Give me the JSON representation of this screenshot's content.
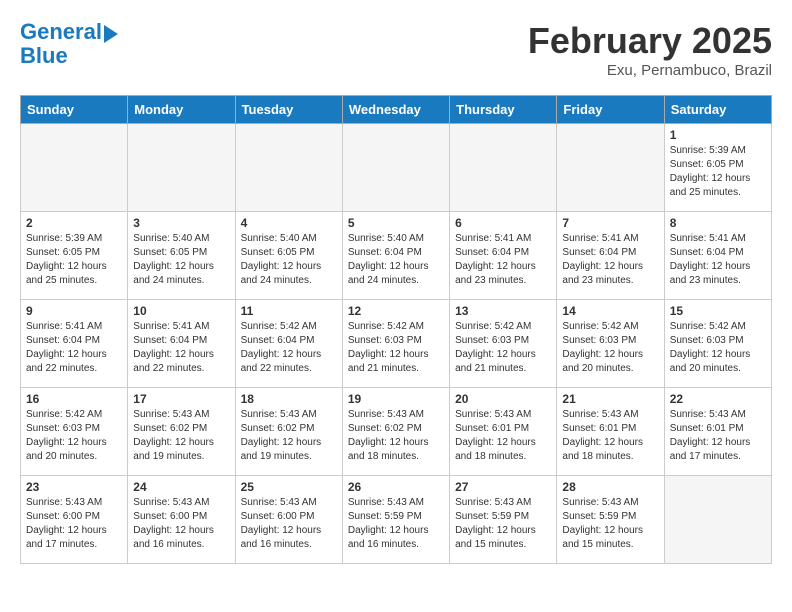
{
  "logo": {
    "line1": "General",
    "line2": "Blue"
  },
  "title": "February 2025",
  "subtitle": "Exu, Pernambuco, Brazil",
  "weekdays": [
    "Sunday",
    "Monday",
    "Tuesday",
    "Wednesday",
    "Thursday",
    "Friday",
    "Saturday"
  ],
  "weeks": [
    [
      {
        "day": "",
        "info": ""
      },
      {
        "day": "",
        "info": ""
      },
      {
        "day": "",
        "info": ""
      },
      {
        "day": "",
        "info": ""
      },
      {
        "day": "",
        "info": ""
      },
      {
        "day": "",
        "info": ""
      },
      {
        "day": "1",
        "info": "Sunrise: 5:39 AM\nSunset: 6:05 PM\nDaylight: 12 hours\nand 25 minutes."
      }
    ],
    [
      {
        "day": "2",
        "info": "Sunrise: 5:39 AM\nSunset: 6:05 PM\nDaylight: 12 hours\nand 25 minutes."
      },
      {
        "day": "3",
        "info": "Sunrise: 5:40 AM\nSunset: 6:05 PM\nDaylight: 12 hours\nand 24 minutes."
      },
      {
        "day": "4",
        "info": "Sunrise: 5:40 AM\nSunset: 6:05 PM\nDaylight: 12 hours\nand 24 minutes."
      },
      {
        "day": "5",
        "info": "Sunrise: 5:40 AM\nSunset: 6:04 PM\nDaylight: 12 hours\nand 24 minutes."
      },
      {
        "day": "6",
        "info": "Sunrise: 5:41 AM\nSunset: 6:04 PM\nDaylight: 12 hours\nand 23 minutes."
      },
      {
        "day": "7",
        "info": "Sunrise: 5:41 AM\nSunset: 6:04 PM\nDaylight: 12 hours\nand 23 minutes."
      },
      {
        "day": "8",
        "info": "Sunrise: 5:41 AM\nSunset: 6:04 PM\nDaylight: 12 hours\nand 23 minutes."
      }
    ],
    [
      {
        "day": "9",
        "info": "Sunrise: 5:41 AM\nSunset: 6:04 PM\nDaylight: 12 hours\nand 22 minutes."
      },
      {
        "day": "10",
        "info": "Sunrise: 5:41 AM\nSunset: 6:04 PM\nDaylight: 12 hours\nand 22 minutes."
      },
      {
        "day": "11",
        "info": "Sunrise: 5:42 AM\nSunset: 6:04 PM\nDaylight: 12 hours\nand 22 minutes."
      },
      {
        "day": "12",
        "info": "Sunrise: 5:42 AM\nSunset: 6:03 PM\nDaylight: 12 hours\nand 21 minutes."
      },
      {
        "day": "13",
        "info": "Sunrise: 5:42 AM\nSunset: 6:03 PM\nDaylight: 12 hours\nand 21 minutes."
      },
      {
        "day": "14",
        "info": "Sunrise: 5:42 AM\nSunset: 6:03 PM\nDaylight: 12 hours\nand 20 minutes."
      },
      {
        "day": "15",
        "info": "Sunrise: 5:42 AM\nSunset: 6:03 PM\nDaylight: 12 hours\nand 20 minutes."
      }
    ],
    [
      {
        "day": "16",
        "info": "Sunrise: 5:42 AM\nSunset: 6:03 PM\nDaylight: 12 hours\nand 20 minutes."
      },
      {
        "day": "17",
        "info": "Sunrise: 5:43 AM\nSunset: 6:02 PM\nDaylight: 12 hours\nand 19 minutes."
      },
      {
        "day": "18",
        "info": "Sunrise: 5:43 AM\nSunset: 6:02 PM\nDaylight: 12 hours\nand 19 minutes."
      },
      {
        "day": "19",
        "info": "Sunrise: 5:43 AM\nSunset: 6:02 PM\nDaylight: 12 hours\nand 18 minutes."
      },
      {
        "day": "20",
        "info": "Sunrise: 5:43 AM\nSunset: 6:01 PM\nDaylight: 12 hours\nand 18 minutes."
      },
      {
        "day": "21",
        "info": "Sunrise: 5:43 AM\nSunset: 6:01 PM\nDaylight: 12 hours\nand 18 minutes."
      },
      {
        "day": "22",
        "info": "Sunrise: 5:43 AM\nSunset: 6:01 PM\nDaylight: 12 hours\nand 17 minutes."
      }
    ],
    [
      {
        "day": "23",
        "info": "Sunrise: 5:43 AM\nSunset: 6:00 PM\nDaylight: 12 hours\nand 17 minutes."
      },
      {
        "day": "24",
        "info": "Sunrise: 5:43 AM\nSunset: 6:00 PM\nDaylight: 12 hours\nand 16 minutes."
      },
      {
        "day": "25",
        "info": "Sunrise: 5:43 AM\nSunset: 6:00 PM\nDaylight: 12 hours\nand 16 minutes."
      },
      {
        "day": "26",
        "info": "Sunrise: 5:43 AM\nSunset: 5:59 PM\nDaylight: 12 hours\nand 16 minutes."
      },
      {
        "day": "27",
        "info": "Sunrise: 5:43 AM\nSunset: 5:59 PM\nDaylight: 12 hours\nand 15 minutes."
      },
      {
        "day": "28",
        "info": "Sunrise: 5:43 AM\nSunset: 5:59 PM\nDaylight: 12 hours\nand 15 minutes."
      },
      {
        "day": "",
        "info": ""
      }
    ]
  ]
}
